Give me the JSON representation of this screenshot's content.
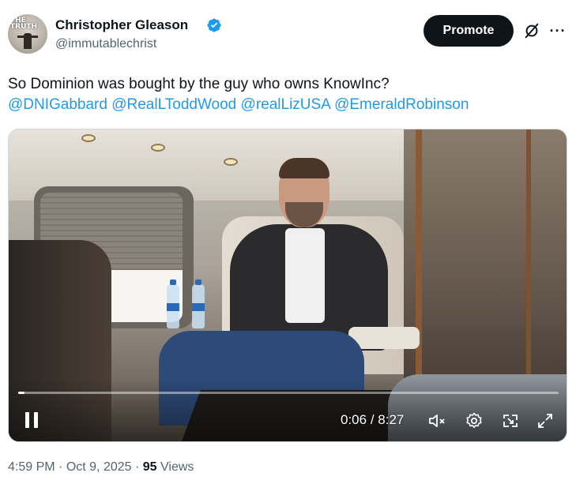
{
  "author": {
    "name": "Christopher Gleason",
    "handle": "@immutablechrist",
    "avatar_logo_text": "THE TRUTH",
    "verified": true
  },
  "actions": {
    "promote_label": "Promote",
    "grok_icon": "grok-icon",
    "more_icon": "more-icon"
  },
  "tweet": {
    "text": "So Dominion was bought by the guy who owns KnowInc?",
    "mentions": [
      "@DNIGabbard",
      "@RealLToddWood",
      "@realLizUSA",
      "@EmeraldRobinson"
    ]
  },
  "video": {
    "elapsed": "0:06",
    "duration": "8:27",
    "time_separator": " / ",
    "progress_fraction": 0.012,
    "state": "playing",
    "controls": [
      "pause-icon",
      "mute-icon",
      "settings-icon",
      "pip-icon",
      "fullscreen-icon"
    ]
  },
  "meta": {
    "time": "4:59 PM",
    "date": "Oct 9, 2025",
    "separator": " · ",
    "views_count": "95",
    "views_label": "Views"
  },
  "colors": {
    "link": "#1d9bf0",
    "verified": "#1d9bf0",
    "secondary_text": "#536471",
    "button_bg": "#0f1419"
  }
}
